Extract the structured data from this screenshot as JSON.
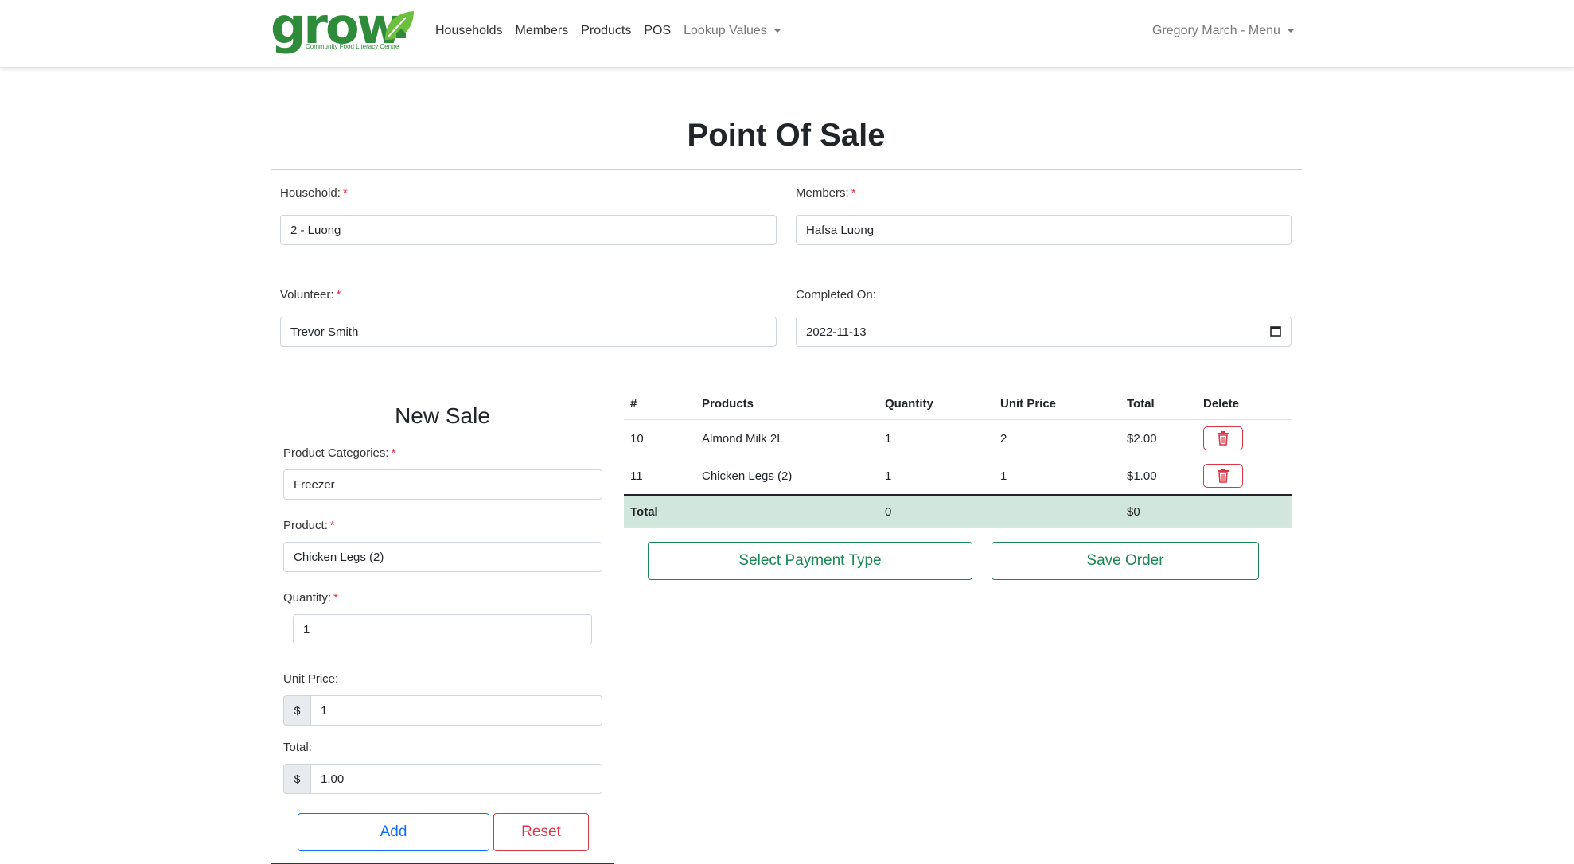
{
  "navbar": {
    "logo_text": "grow",
    "logo_subtitle": "Community Food Literacy Centre",
    "links": [
      "Households",
      "Members",
      "Products",
      "POS"
    ],
    "lookup_label": "Lookup Values",
    "user_menu": "Gregory March - Menu"
  },
  "page": {
    "title": "Point Of Sale"
  },
  "form": {
    "household": {
      "label": "Household:",
      "value": "2 - Luong"
    },
    "members": {
      "label": "Members:",
      "value": "Hafsa Luong"
    },
    "volunteer": {
      "label": "Volunteer:",
      "value": "Trevor Smith"
    },
    "completed_on": {
      "label": "Completed On:",
      "value": "2022-11-13"
    },
    "required_mark": "*"
  },
  "new_sale": {
    "title": "New Sale",
    "category": {
      "label": "Product Categories:",
      "value": "Freezer"
    },
    "product": {
      "label": "Product:",
      "value": "Chicken Legs (2)"
    },
    "quantity": {
      "label": "Quantity:",
      "value": "1"
    },
    "unit_price": {
      "label": "Unit Price:",
      "prefix": "$",
      "value": "1"
    },
    "total": {
      "label": "Total:",
      "prefix": "$",
      "value": "1.00"
    },
    "add_label": "Add",
    "reset_label": "Reset"
  },
  "table": {
    "headers": [
      "#",
      "Products",
      "Quantity",
      "Unit Price",
      "Total",
      "Delete"
    ],
    "rows": [
      {
        "id": "10",
        "product": "Almond Milk 2L",
        "quantity": "1",
        "unit_price": "2",
        "total": "$2.00"
      },
      {
        "id": "11",
        "product": "Chicken Legs (2)",
        "quantity": "1",
        "unit_price": "1",
        "total": "$1.00"
      }
    ],
    "total_row": {
      "label": "Total",
      "quantity": "0",
      "total": "$0"
    }
  },
  "actions": {
    "payment_label": "Select Payment Type",
    "save_label": "Save Order"
  },
  "colors": {
    "brand_green": "#2e8b3a",
    "success": "#198754",
    "danger": "#dc3545",
    "primary": "#0d6efd",
    "total_row_bg": "#d1e7dd"
  }
}
